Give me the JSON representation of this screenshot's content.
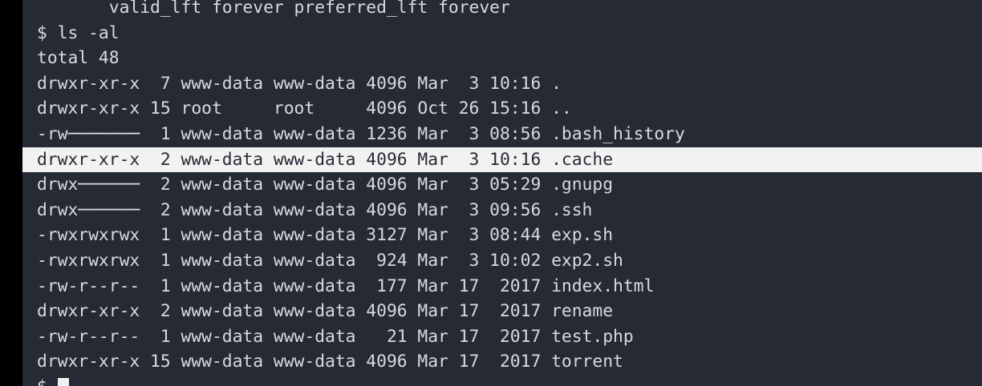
{
  "terminal": {
    "colors": {
      "background": "#262a34",
      "text": "#d8dadf",
      "highlight_bg": "#f2f2f2",
      "highlight_text": "#262a34",
      "frame": "#000000"
    },
    "lines": [
      "       valid_lft forever preferred_lft forever",
      "$ ls -al",
      "total 48",
      "drwxr-xr-x  7 www-data www-data 4096 Mar  3 10:16 .",
      "drwxr-xr-x 15 root     root     4096 Oct 26 15:16 ..",
      "-rw───────  1 www-data www-data 1236 Mar  3 08:56 .bash_history",
      "drwxr-xr-x  2 www-data www-data 4096 Mar  3 10:16 .cache",
      "drwx──────  2 www-data www-data 4096 Mar  3 05:29 .gnupg",
      "drwx──────  2 www-data www-data 4096 Mar  3 09:56 .ssh",
      "-rwxrwxrwx  1 www-data www-data 3127 Mar  3 08:44 exp.sh",
      "-rwxrwxrwx  1 www-data www-data  924 Mar  3 10:02 exp2.sh",
      "-rw-r--r--  1 www-data www-data  177 Mar 17  2017 index.html",
      "drwxr-xr-x  2 www-data www-data 4096 Mar 17  2017 rename",
      "-rw-r--r--  1 www-data www-data   21 Mar 17  2017 test.php",
      "drwxr-xr-x 15 www-data www-data 4096 Mar 17  2017 torrent"
    ],
    "prompt": "$ "
  }
}
